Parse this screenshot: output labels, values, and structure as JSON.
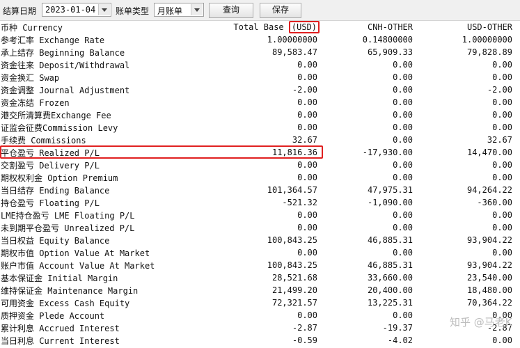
{
  "toolbar": {
    "settle_date_label": "结算日期",
    "settle_date_value": "2023-01-04",
    "bill_type_label": "账单类型",
    "bill_type_value": "月账单",
    "query_button": "查询",
    "save_button": "保存"
  },
  "table": {
    "header": {
      "currency": "币种 Currency",
      "total_base": "Total Base",
      "usd_tag": "(USD)",
      "cnh": "CNH-OTHER",
      "usd": "USD-OTHER"
    },
    "rows": [
      {
        "label": "参考汇率 Exchange Rate",
        "total": "1.00000000",
        "cnh": "0.14800000",
        "usd": "1.00000000"
      },
      {
        "label": "承上结存 Beginning Balance",
        "total": "89,583.47",
        "cnh": "65,909.33",
        "usd": "79,828.89"
      },
      {
        "label": "资金往来 Deposit/Withdrawal",
        "total": "0.00",
        "cnh": "0.00",
        "usd": "0.00"
      },
      {
        "label": "资金换汇 Swap",
        "total": "0.00",
        "cnh": "0.00",
        "usd": "0.00"
      },
      {
        "label": "资金调整 Journal Adjustment",
        "total": "-2.00",
        "cnh": "0.00",
        "usd": "-2.00"
      },
      {
        "label": "资金冻结 Frozen",
        "total": "0.00",
        "cnh": "0.00",
        "usd": "0.00"
      },
      {
        "label": "港交所清算费Exchange Fee",
        "total": "0.00",
        "cnh": "0.00",
        "usd": "0.00"
      },
      {
        "label": "证监会征费Commission Levy",
        "total": "0.00",
        "cnh": "0.00",
        "usd": "0.00"
      },
      {
        "label": "手续费 Commissions",
        "total": "32.67",
        "cnh": "0.00",
        "usd": "32.67"
      },
      {
        "label": "平仓盈亏 Realized P/L",
        "total": "11,816.36",
        "cnh": "-17,930.00",
        "usd": "14,470.00"
      },
      {
        "label": "交割盈亏 Delivery P/L",
        "total": "0.00",
        "cnh": "0.00",
        "usd": "0.00"
      },
      {
        "label": "期权权利金 Option Premium",
        "total": "0.00",
        "cnh": "0.00",
        "usd": "0.00"
      },
      {
        "label": "当日结存 Ending Balance",
        "total": "101,364.57",
        "cnh": "47,975.31",
        "usd": "94,264.22"
      },
      {
        "label": "持仓盈亏 Floating P/L",
        "total": "-521.32",
        "cnh": "-1,090.00",
        "usd": "-360.00"
      },
      {
        "label": "LME持仓盈亏 LME Floating P/L",
        "total": "0.00",
        "cnh": "0.00",
        "usd": "0.00"
      },
      {
        "label": "未到期平仓盈亏 Unrealized P/L",
        "total": "0.00",
        "cnh": "0.00",
        "usd": "0.00"
      },
      {
        "label": "当日权益 Equity Balance",
        "total": "100,843.25",
        "cnh": "46,885.31",
        "usd": "93,904.22"
      },
      {
        "label": "期权市值 Option Value At Market",
        "total": "0.00",
        "cnh": "0.00",
        "usd": "0.00"
      },
      {
        "label": "账户市值 Account Value At Market",
        "total": "100,843.25",
        "cnh": "46,885.31",
        "usd": "93,904.22"
      },
      {
        "label": "基本保证金 Initial Margin",
        "total": "28,521.68",
        "cnh": "33,660.00",
        "usd": "23,540.00"
      },
      {
        "label": "维持保证金 Maintenance Margin",
        "total": "21,499.20",
        "cnh": "20,400.00",
        "usd": "18,480.00"
      },
      {
        "label": "可用资金 Excess Cash Equity",
        "total": "72,321.57",
        "cnh": "13,225.31",
        "usd": "70,364.22"
      },
      {
        "label": "质押资金 Plede Account",
        "total": "0.00",
        "cnh": "0.00",
        "usd": "0.00"
      },
      {
        "label": "累计利息 Accrued Interest",
        "total": "-2.87",
        "cnh": "-19.37",
        "usd": "-2.87"
      },
      {
        "label": "当日利息 Current Interest",
        "total": "-0.59",
        "cnh": "-4.02",
        "usd": "0.00"
      }
    ]
  },
  "watermark": "知乎 @马老K",
  "colors": {
    "highlight": "#e02020"
  }
}
